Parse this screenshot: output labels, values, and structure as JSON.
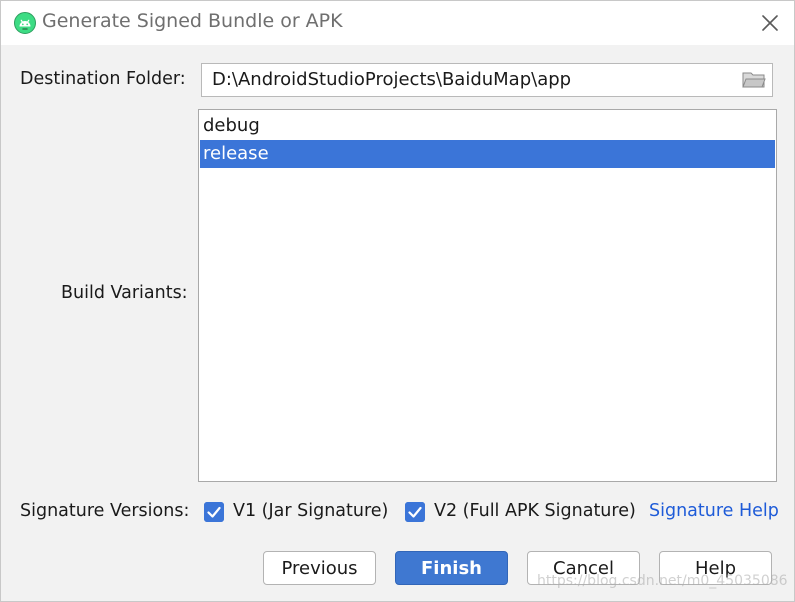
{
  "window": {
    "title": "Generate Signed Bundle or APK",
    "app_icon": "android-studio-icon",
    "close_icon": "close-icon"
  },
  "destination": {
    "label": "Destination Folder:",
    "value": "D:\\AndroidStudioProjects\\BaiduMap\\app",
    "browse_icon": "folder-icon"
  },
  "build_variants": {
    "label": "Build Variants:",
    "items": [
      {
        "label": "debug",
        "selected": false
      },
      {
        "label": "release",
        "selected": true
      }
    ]
  },
  "signature": {
    "label": "Signature Versions:",
    "v1": {
      "label": "V1 (Jar Signature)",
      "checked": true
    },
    "v2": {
      "label": "V2 (Full APK Signature)",
      "checked": true
    },
    "help_link": "Signature Help"
  },
  "buttons": {
    "previous": "Previous",
    "finish": "Finish",
    "cancel": "Cancel",
    "help": "Help"
  },
  "watermark": "https://blog.csdn.net/m0_45035086",
  "colors": {
    "accent": "#3b75d8",
    "link": "#1e5bd8",
    "title_text": "#6f6f6f"
  }
}
